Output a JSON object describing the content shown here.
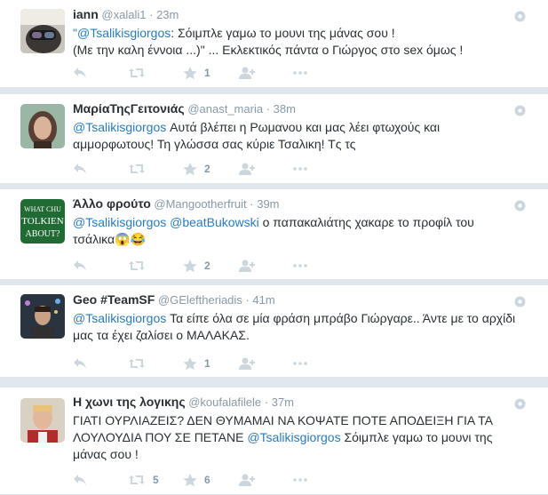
{
  "tweets": [
    {
      "fullname": "iann",
      "username": "@xalali1",
      "time": "23m",
      "parts": [
        {
          "t": "\"",
          "c": "quote-mark"
        },
        {
          "t": "@Tsalikisgiorgos",
          "c": "mention"
        },
        {
          "t": ": Σόιμπλε γαμω το μουνι της μάνας σου !",
          "c": ""
        },
        {
          "t": "\n(Με την καλη έννοια ...)\" ... Εκλεκτικός πάντα ο Γιώργος στο sex όμως !",
          "c": ""
        }
      ],
      "retweets": "",
      "favorites": "1"
    },
    {
      "fullname": "ΜαρίαΤηςΓειτονιάς",
      "username": "@anast_maria",
      "time": "38m",
      "parts": [
        {
          "t": "@Tsalikisgiorgos",
          "c": "mention"
        },
        {
          "t": " Αυτά βλέπει η Ρωμανου και μας λέει φτωχούς και αμμορφωτους!  Τη γλώσσα σας κύριε Τσαλικη!  Τς τς",
          "c": ""
        }
      ],
      "retweets": "",
      "favorites": "2"
    },
    {
      "fullname": "Άλλο φρούτο",
      "username": "@Mangootherfruit",
      "time": "39m",
      "parts": [
        {
          "t": "@Tsalikisgiorgos",
          "c": "mention"
        },
        {
          "t": " ",
          "c": ""
        },
        {
          "t": "@beatBukowski",
          "c": "mention"
        },
        {
          "t": " ο παπακαλιάτης χακαρε το προφίλ του τσάλικα😱😂",
          "c": ""
        }
      ],
      "retweets": "",
      "favorites": "2"
    },
    {
      "fullname": "Geo #TeamSF",
      "username": "@GEleftheriadis",
      "time": "41m",
      "parts": [
        {
          "t": "@Tsalikisgiorgos",
          "c": "mention"
        },
        {
          "t": " Τα είπε όλα σε μία φράση μπράβο Γιώργαρε.. Άντε με το αρχίδι μας τα έχει ζαλίσει ο ΜΑΛΑΚΑΣ.",
          "c": ""
        }
      ],
      "retweets": "",
      "favorites": "1"
    },
    {
      "fullname": "Η χωνι της λογικης",
      "username": "@koufalafilele",
      "time": "37m",
      "parts": [
        {
          "t": "ΓΙΑΤΙ ΟΥΡΛΙΑΖΕΙΣ? ΔΕΝ ΘΥΜΑΜΑΙ ΝΑ ΚΟΨΑΤΕ ΠΟΤΕ ΑΠΟΔΕΙΞΗ ΓΙΑ ΤΑ ΛΟΥΛΟΥΔΙΑ ΠΟΥ ΣΕ ΠΕΤΑΝΕ ",
          "c": ""
        },
        {
          "t": "@Tsalikisgiorgos",
          "c": "mention"
        },
        {
          "t": " Σόιμπλε γαμω το μουνι της μάνας σου !",
          "c": ""
        }
      ],
      "retweets": "5",
      "favorites": "6"
    }
  ],
  "avatar3_text": [
    "WHAT CHU",
    "TOLKIEN",
    "ABOUT?"
  ],
  "colors": {
    "link": "#2b7bb9",
    "muted": "#8899a6",
    "action_icon": "#ccd6dd",
    "background": "#e1e8ed"
  },
  "icons": [
    "reply-icon",
    "retweet-icon",
    "favorite-icon",
    "follow-icon",
    "more-icon",
    "gear-icon"
  ]
}
